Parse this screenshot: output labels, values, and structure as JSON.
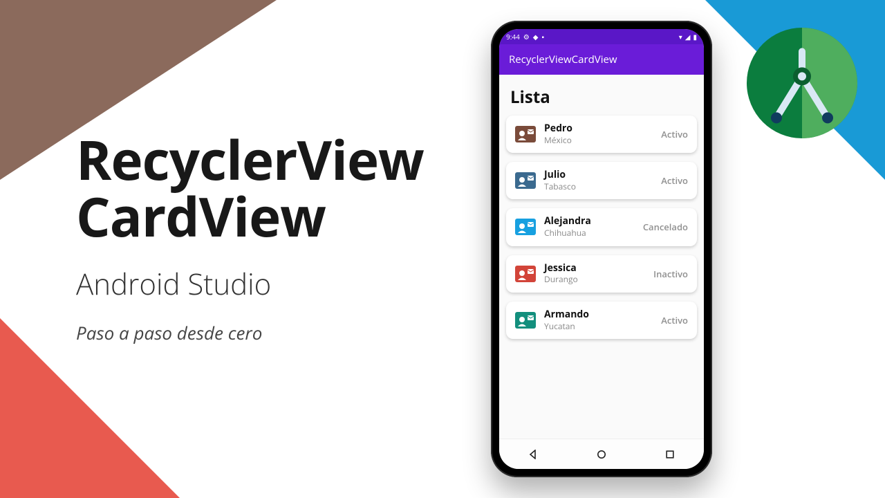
{
  "decor": {
    "colors": {
      "top_left": "#8b6a5c",
      "top_right": "#199ad6",
      "bottom_left": "#e85a4f"
    }
  },
  "text": {
    "title_line1": "RecyclerView",
    "title_line2": "CardView",
    "subtitle": "Android Studio",
    "tagline": "Paso a paso desde cero"
  },
  "phone": {
    "status": {
      "time": "9:44",
      "left_icons": [
        "gear-icon",
        "shield-icon",
        "square-icon"
      ],
      "right_icons": [
        "wifi-icon",
        "signal-icon",
        "battery-icon"
      ]
    },
    "app_bar_title": "RecyclerViewCardView",
    "list_title": "Lista",
    "items": [
      {
        "name": "Pedro",
        "location": "México",
        "status": "Activo",
        "color": "#7a4b3a"
      },
      {
        "name": "Julio",
        "location": "Tabasco",
        "status": "Activo",
        "color": "#3b6a8f"
      },
      {
        "name": "Alejandra",
        "location": "Chihuahua",
        "status": "Cancelado",
        "color": "#17a0e0"
      },
      {
        "name": "Jessica",
        "location": "Durango",
        "status": "Inactivo",
        "color": "#d24439"
      },
      {
        "name": "Armando",
        "location": "Yucatan",
        "status": "Activo",
        "color": "#138f7d"
      }
    ],
    "nav": [
      "back-icon",
      "home-icon",
      "recents-icon"
    ]
  }
}
